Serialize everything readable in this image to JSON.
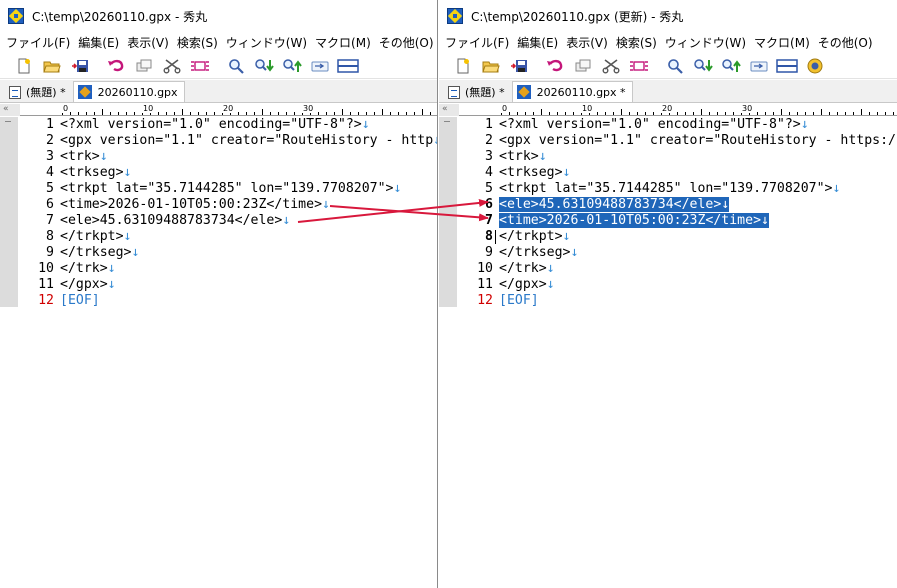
{
  "left": {
    "title": "C:\\temp\\20260110.gpx  - 秀丸",
    "menu": [
      "ファイル(F)",
      "編集(E)",
      "表示(V)",
      "検索(S)",
      "ウィンドウ(W)",
      "マクロ(M)",
      "その他(O)"
    ],
    "tabs": [
      {
        "label": "(無題) *"
      },
      {
        "label": "20260110.gpx"
      }
    ],
    "ruler": {
      "corner": "«",
      "marks": [
        "0",
        "10",
        "20",
        "30"
      ]
    },
    "lines": [
      {
        "n": "1",
        "text": "<?xml version=\"1.0\" encoding=\"UTF-8\"?>"
      },
      {
        "n": "2",
        "text": "<gpx version=\"1.1\" creator=\"RouteHistory - http"
      },
      {
        "n": "3",
        "text": "<trk>"
      },
      {
        "n": "4",
        "text": "<trkseg>"
      },
      {
        "n": "5",
        "text": "<trkpt lat=\"35.7144285\" lon=\"139.7708207\">"
      },
      {
        "n": "6",
        "text": "<time>2026-01-10T05:00:23Z</time>"
      },
      {
        "n": "7",
        "text": "<ele>45.63109488783734</ele>"
      },
      {
        "n": "8",
        "text": "</trkpt>"
      },
      {
        "n": "9",
        "text": "</trkseg>"
      },
      {
        "n": "10",
        "text": "</trk>"
      },
      {
        "n": "11",
        "text": "</gpx>"
      },
      {
        "n": "12",
        "text": "[EOF]"
      }
    ]
  },
  "right": {
    "title": "C:\\temp\\20260110.gpx (更新) - 秀丸",
    "menu": [
      "ファイル(F)",
      "編集(E)",
      "表示(V)",
      "検索(S)",
      "ウィンドウ(W)",
      "マクロ(M)",
      "その他(O)"
    ],
    "tabs": [
      {
        "label": "(無題) *"
      },
      {
        "label": "20260110.gpx *"
      }
    ],
    "ruler": {
      "corner": "«",
      "marks": [
        "0",
        "10",
        "20",
        "30"
      ]
    },
    "lines": [
      {
        "n": "1",
        "text": "<?xml version=\"1.0\" encoding=\"UTF-8\"?>"
      },
      {
        "n": "2",
        "text": "<gpx version=\"1.1\" creator=\"RouteHistory - https:/"
      },
      {
        "n": "3",
        "text": "<trk>"
      },
      {
        "n": "4",
        "text": "<trkseg>"
      },
      {
        "n": "5",
        "text": "<trkpt lat=\"35.7144285\" lon=\"139.7708207\">"
      },
      {
        "n": "6",
        "text": "<ele>45.63109488783734</ele>"
      },
      {
        "n": "7",
        "text": "<time>2026-01-10T05:00:23Z</time>"
      },
      {
        "n": "8",
        "text": "</trkpt>"
      },
      {
        "n": "9",
        "text": "</trkseg>"
      },
      {
        "n": "10",
        "text": "</trk>"
      },
      {
        "n": "11",
        "text": "</gpx>"
      },
      {
        "n": "12",
        "text": "[EOF]"
      }
    ]
  },
  "newline_glyph": "↓",
  "toolbar_icons": [
    "new-file-icon",
    "open-folder-icon",
    "save-icon",
    "undo-icon",
    "copy-icon",
    "cut-icon",
    "paste-icon",
    "search-icon",
    "search-down-icon",
    "search-up-icon",
    "jump-icon",
    "split-window-icon",
    "macro-icon"
  ],
  "colors": {
    "selection": "#1f66b9",
    "newline_mark": "#3a8fd6",
    "eof_number": "#d00000",
    "arrow": "#d8183c",
    "gutter": "#dcdcdc"
  }
}
